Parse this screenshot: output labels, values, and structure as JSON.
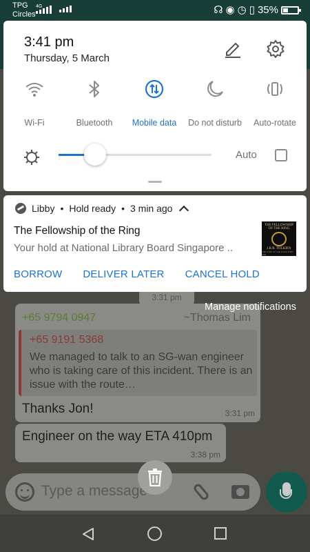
{
  "status_bar": {
    "carrier_top": "TPG",
    "carrier_bottom": "Circles",
    "network_type": "4G",
    "battery_percent": "35%",
    "icons": [
      "headset-icon",
      "eye-icon",
      "alarm-icon",
      "vibrate-icon"
    ]
  },
  "quick_settings": {
    "time": "3:41 pm",
    "date": "Thursday, 5 March",
    "tiles": [
      {
        "label": "Wi-Fi",
        "icon": "wifi-icon",
        "active": false
      },
      {
        "label": "Bluetooth",
        "icon": "bluetooth-icon",
        "active": false
      },
      {
        "label": "Mobile data",
        "icon": "mobile-data-icon",
        "active": true
      },
      {
        "label": "Do not disturb",
        "icon": "moon-icon",
        "active": false
      },
      {
        "label": "Auto-rotate",
        "icon": "rotate-icon",
        "active": false
      }
    ],
    "brightness_level": 0.24,
    "auto_label": "Auto",
    "auto_checked": false,
    "accent_color": "#1a73d1"
  },
  "notification": {
    "app": "Libby",
    "summary": "Hold ready",
    "time_ago": "3 min ago",
    "title": "The Fellowship of the Ring",
    "body": "Your hold at National Library Board Singapore ..",
    "cover": {
      "title": "THE FELLOWSHIP OF THE RING",
      "author": "J.R.R. TOLKIEN",
      "subtitle": "THE LORD OF THE RINGS PART ONE"
    },
    "actions": [
      "BORROW",
      "DELIVER LATER",
      "CANCEL HOLD"
    ]
  },
  "manage_notifications": "Manage notifications",
  "chat": {
    "top_time": "3:31 pm",
    "sender_number": "+65 9794 0947",
    "sender_name": "~Thomas Lim",
    "quoted_number": "+65 9191 5368",
    "quoted_text": "We managed to talk to an SG-wan engineer who is taking care of this incident. There is an issue with the route…",
    "message_1": "Thanks Jon!",
    "message_1_time": "3:31 pm",
    "message_2": "Engineer on the way ETA 410pm",
    "message_2_time": "3:38 pm",
    "input_placeholder": "Type a message"
  }
}
